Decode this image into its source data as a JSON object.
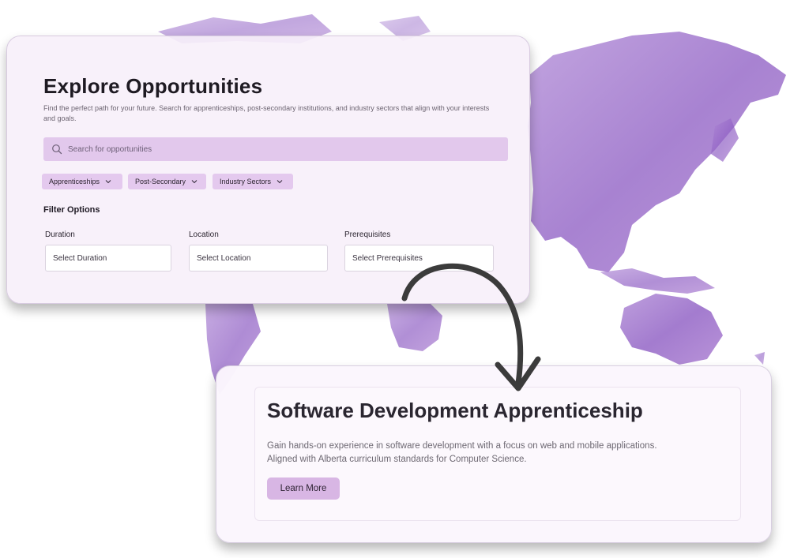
{
  "explore": {
    "title": "Explore Opportunities",
    "subtitle": "Find the perfect path for your future. Search for apprenticeships, post-secondary institutions, and industry sectors that align with your interests and goals.",
    "search": {
      "placeholder": "Search for opportunities",
      "icon": "search-icon"
    },
    "categories": [
      {
        "label": "Apprenticeships",
        "icon": "chevron-down-icon"
      },
      {
        "label": "Post-Secondary",
        "icon": "chevron-down-icon"
      },
      {
        "label": "Industry Sectors",
        "icon": "chevron-down-icon"
      }
    ],
    "filters": {
      "heading": "Filter Options",
      "fields": [
        {
          "label": "Duration",
          "value": "Select Duration"
        },
        {
          "label": "Location",
          "value": "Select Location"
        },
        {
          "label": "Prerequisites",
          "value": "Select Prerequisites"
        }
      ]
    }
  },
  "detail": {
    "title": "Software Development Apprenticeship",
    "description": "Gain hands-on experience in software development with a focus on web and mobile applications. Aligned with Alberta curriculum standards for Computer Science.",
    "button_label": "Learn More"
  },
  "colors": {
    "accent": "#d8b6e4",
    "chip": "#e4c9ee",
    "map": "#9b6fc6"
  }
}
